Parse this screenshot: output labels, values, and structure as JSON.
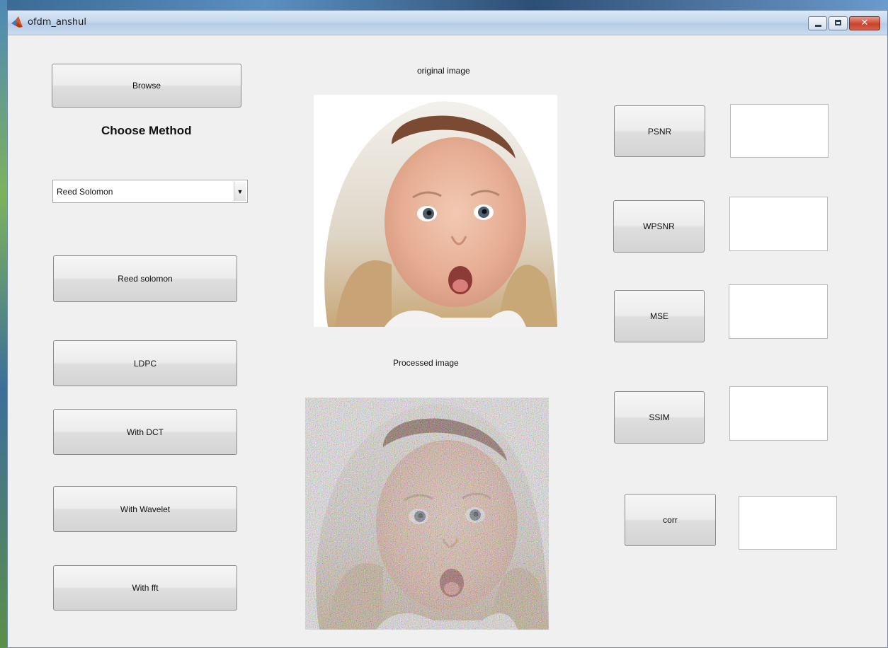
{
  "window": {
    "title": "ofdm_anshul",
    "controls": {
      "minimize": "minimize",
      "maximize": "maximize",
      "close": "✕"
    }
  },
  "left_panel": {
    "browse_label": "Browse",
    "choose_method_label": "Choose Method",
    "method_select": {
      "selected": "Reed Solomon"
    },
    "buttons": {
      "reed_solomon": "Reed solomon",
      "ldpc": "LDPC",
      "with_dct": "With DCT",
      "with_wavelet": "With Wavelet",
      "with_fft": "With fft"
    }
  },
  "images": {
    "original_label": "original image",
    "processed_label": "Processed image"
  },
  "metrics": {
    "psnr": {
      "label": "PSNR",
      "value": ""
    },
    "wpsnr": {
      "label": "WPSNR",
      "value": ""
    },
    "mse": {
      "label": "MSE",
      "value": ""
    },
    "ssim": {
      "label": "SSIM",
      "value": ""
    },
    "corr": {
      "label": "corr",
      "value": ""
    }
  },
  "colors": {
    "window_bg": "#f0f0f0",
    "titlebar": "#c4d8ee",
    "close_button": "#c8432d"
  }
}
